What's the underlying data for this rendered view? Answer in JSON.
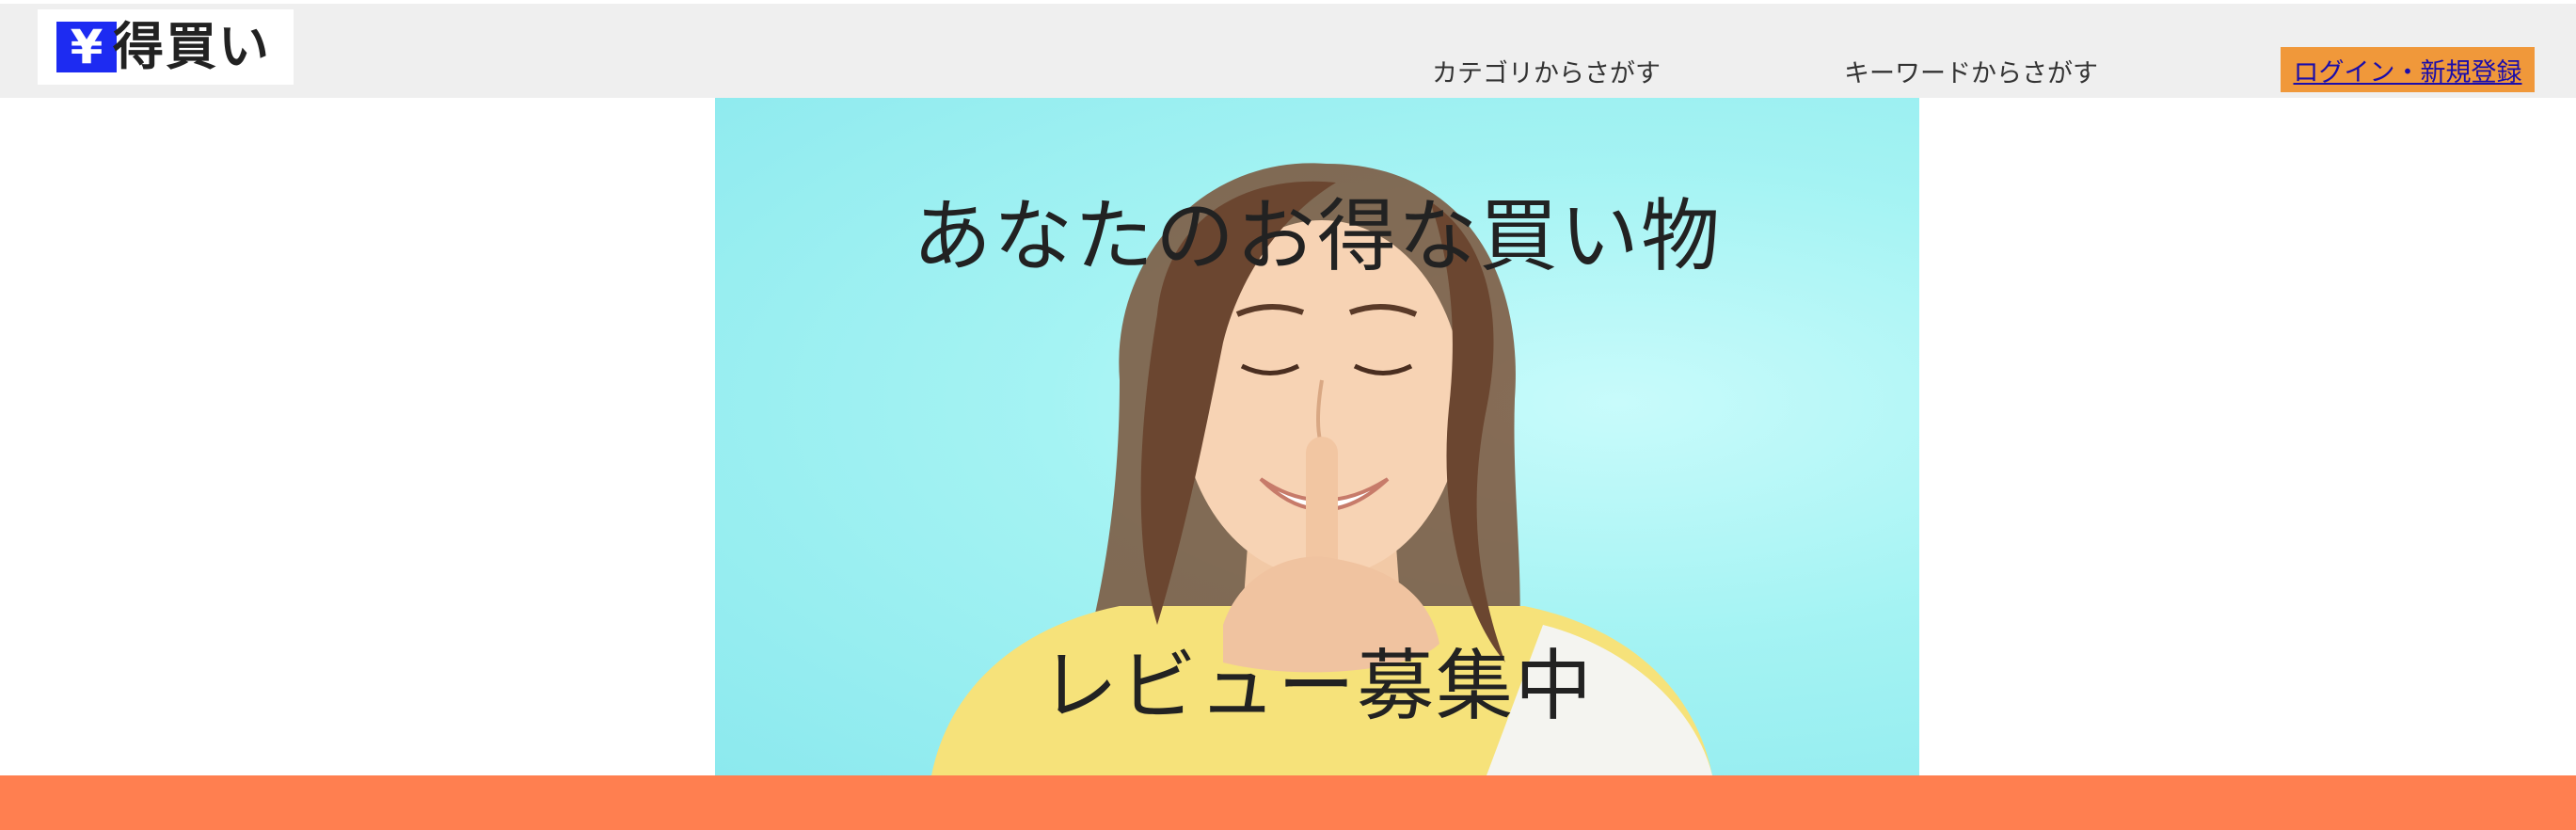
{
  "header": {
    "logo_mark": "¥",
    "logo_text": "得買い",
    "nav": {
      "category": "カテゴリからさがす",
      "keyword": "キーワードからさがす"
    },
    "login_label": "ログイン・新規登録"
  },
  "hero": {
    "title": "あなたのお得な買い物",
    "subtitle": "レビュー募集中",
    "image_alt": "woman-with-finger-on-lips"
  },
  "colors": {
    "header_bg": "#efefef",
    "logo_accent": "#1d2bf2",
    "login_bg": "#f0983a",
    "hero_bg": "#a4f3f3",
    "footer_bar": "#ff7f50"
  }
}
